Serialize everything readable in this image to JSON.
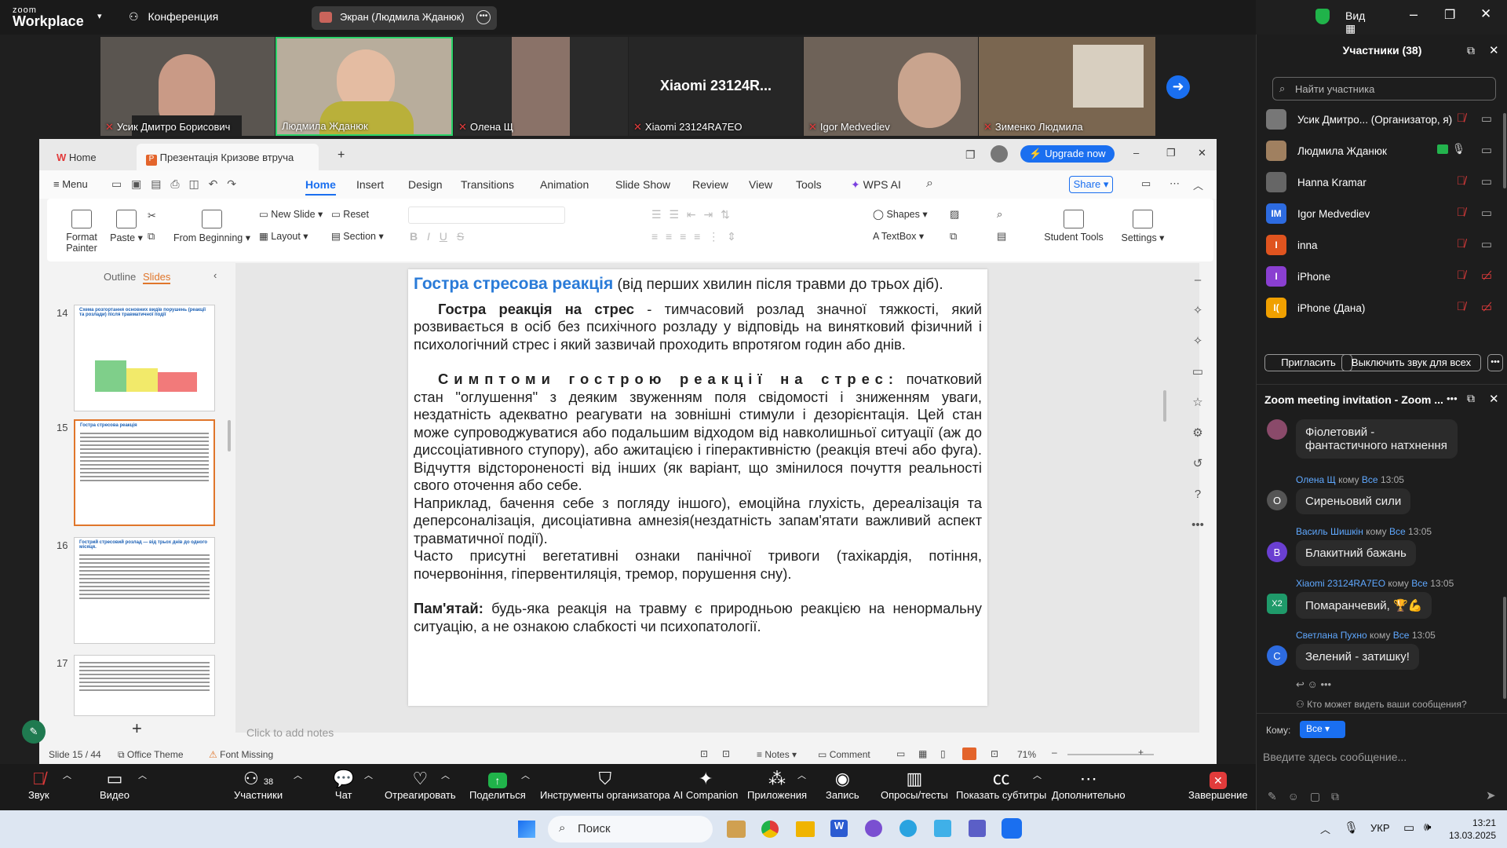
{
  "zoom": {
    "logo_top": "zoom",
    "logo_bottom": "Workplace",
    "conference_label": "Конференция",
    "screen_share_label": "Экран (Людмила Жданюк)",
    "view_label": "Вид",
    "videos": [
      {
        "name": "Усик Дмитро Борисович"
      },
      {
        "name": "Людмила Жданюк"
      },
      {
        "name": "Олена Щ"
      },
      {
        "name": "Xiaomi 23124RA7EO",
        "big": "Xiaomi 23124R..."
      },
      {
        "name": "Igor Medvediev"
      },
      {
        "name": "Зименко Людмила"
      }
    ],
    "toolbar": [
      {
        "label": "Звук",
        "icon": "mic-muted-icon"
      },
      {
        "label": "Видео",
        "icon": "camera-icon"
      },
      {
        "label": "Участники",
        "icon": "participants-icon",
        "count": "38"
      },
      {
        "label": "Чат",
        "icon": "chat-icon"
      },
      {
        "label": "Отреагировать",
        "icon": "heart-icon"
      },
      {
        "label": "Поделиться",
        "icon": "share-icon"
      },
      {
        "label": "Инструменты организатора",
        "icon": "shield-icon"
      },
      {
        "label": "AI Companion",
        "icon": "sparkle-icon"
      },
      {
        "label": "Приложения",
        "icon": "apps-icon"
      },
      {
        "label": "Запись",
        "icon": "record-icon"
      },
      {
        "label": "Опросы/тесты",
        "icon": "poll-icon"
      },
      {
        "label": "Показать субтитры",
        "icon": "cc-icon"
      },
      {
        "label": "Дополнительно",
        "icon": "more-icon"
      },
      {
        "label": "Завершение",
        "icon": "end-icon"
      }
    ]
  },
  "participants": {
    "title": "Участники (38)",
    "search_placeholder": "Найти участника",
    "list": [
      {
        "name": "Усик Дмитро... (Организатор, я)",
        "initials": "",
        "color": "#777"
      },
      {
        "name": "Людмила Жданюк",
        "initials": "",
        "color": "#a08060"
      },
      {
        "name": "Hanna Kramar",
        "initials": "",
        "color": "#666"
      },
      {
        "name": "Igor Medvediev",
        "initials": "IM",
        "color": "#2d6be0"
      },
      {
        "name": "inna",
        "initials": "I",
        "color": "#e0541f"
      },
      {
        "name": "iPhone",
        "initials": "I",
        "color": "#8a3fd1"
      },
      {
        "name": "iPhone (Дана)",
        "initials": "I(",
        "color": "#f0a000"
      }
    ],
    "invite_label": "Пригласить",
    "mute_all_label": "Выключить звук для всех"
  },
  "chat": {
    "title": "Zoom meeting invitation - Zoom ...",
    "messages": [
      {
        "sender": "",
        "to": "",
        "time": "",
        "text": "Фіолетовий - фантастичного натхнення",
        "initial": "",
        "color": "#8a4a6a"
      },
      {
        "sender": "Олена Щ",
        "to": "кому",
        "to_who": "Все",
        "time": "13:05",
        "text": "Сиреньовий сили",
        "initial": "О",
        "color": "#555"
      },
      {
        "sender": "Василь Шишкін",
        "to": "кому",
        "to_who": "Все",
        "time": "13:05",
        "text": "Блакитний бажань",
        "initial": "В",
        "color": "#6a3fd1"
      },
      {
        "sender": "Xiaomi 23124RA7EO",
        "to": "кому",
        "to_who": "Все",
        "time": "13:05",
        "text": "Помаранчевий, 🏆💪",
        "initial": "X2",
        "color": "#1f9a6a"
      },
      {
        "sender": "Светлана Пухно",
        "to": "кому",
        "to_who": "Все",
        "time": "13:05",
        "text": "Зелений - затишку!",
        "initial": "С",
        "color": "#2d6be0"
      }
    ],
    "who_can_see": "Кто может видеть ваши сообщения?",
    "to_label": "Кому:",
    "to_value": "Все",
    "input_placeholder": "Введите здесь сообщение..."
  },
  "wps": {
    "tab_home": "Home",
    "tab_doc": "Презентація Кризове втруча",
    "upgrade": "Upgrade now",
    "menu": "Menu",
    "ribbon_tabs": [
      "Home",
      "Insert",
      "Design",
      "Transitions",
      "Animation",
      "Slide Show",
      "Review",
      "View",
      "Tools",
      "WPS AI"
    ],
    "share": "Share",
    "ribbon": {
      "format_painter": "Format Painter",
      "paste": "Paste",
      "from_beginning": "From Beginning",
      "new_slide": "New Slide",
      "reset": "Reset",
      "layout": "Layout",
      "section": "Section",
      "shapes": "Shapes",
      "textbox": "TextBox",
      "student_tools": "Student Tools",
      "settings": "Settings"
    },
    "pane_outline": "Outline",
    "pane_slides": "Slides",
    "thumbs": [
      {
        "num": "14",
        "title": "Схема розгортання основних видів порушень (реакції та розлади) після травматичної події"
      },
      {
        "num": "15",
        "title": "Гостра стресова реакція"
      },
      {
        "num": "16",
        "title": "Гострий стресовий розлад — від трьох днів до одного місяця."
      },
      {
        "num": "17",
        "title": ""
      }
    ],
    "slide": {
      "title_main": "Гостра стресова реакція",
      "title_rest": " (від перших хвилин після травми до трьох діб).",
      "p1_bold": "Гостра реакція на стрес",
      "p1_rest": " - тимчасовий розлад значної тяжкості, який розвивається в осіб без психічного розладу у відповідь на винятковий фізичний і психологічний стрес і який зазвичай проходить впротягом годин або днів.",
      "p2_bold": "Симптоми гострою реакції на стрес:",
      "p2_rest": " початковий стан \"оглушення\" з деяким звуженням поля свідомості і зниженням уваги, нездатність адекватно реагувати на зовнішні стимули і дезорієнтація.  Цей стан може супроводжуватися або подальшим відходом від навколишньої ситуації (аж до диссоціативного ступору), або ажитацією і гіперактивністю (реакція втечі або фуга). Відчуття відстороненості від інших  (як варіант, що змінилося почуття реальності свого оточення або себе.",
      "p3": "Наприклад, бачення себе з погляду іншого), емоційна глухість, дереалізація та деперсоналізація, дисоціативна амнезія(нездатність запам'ятати важливий аспект травматичної події).",
      "p4": "Часто присутні вегетативні ознаки панічної тривоги (тахікардія, потіння, почервоніння, гіпервентиляція, тремор,  порушення сну).",
      "p5_bold": "Пам'ятай:",
      "p5_rest": " будь-яка реакція на травму є природньою реакцією на ненормальну ситуацію, а не ознакою слабкості чи психопатології."
    },
    "notes_placeholder": "Click to add notes",
    "status": {
      "slide": "Slide 15 / 44",
      "theme": "Office Theme",
      "font": "Font Missing",
      "notes": "Notes",
      "comment": "Comment",
      "zoom": "71%"
    }
  },
  "taskbar": {
    "search": "Поиск",
    "lang": "УКР",
    "time": "13:21",
    "date": "13.03.2025"
  }
}
